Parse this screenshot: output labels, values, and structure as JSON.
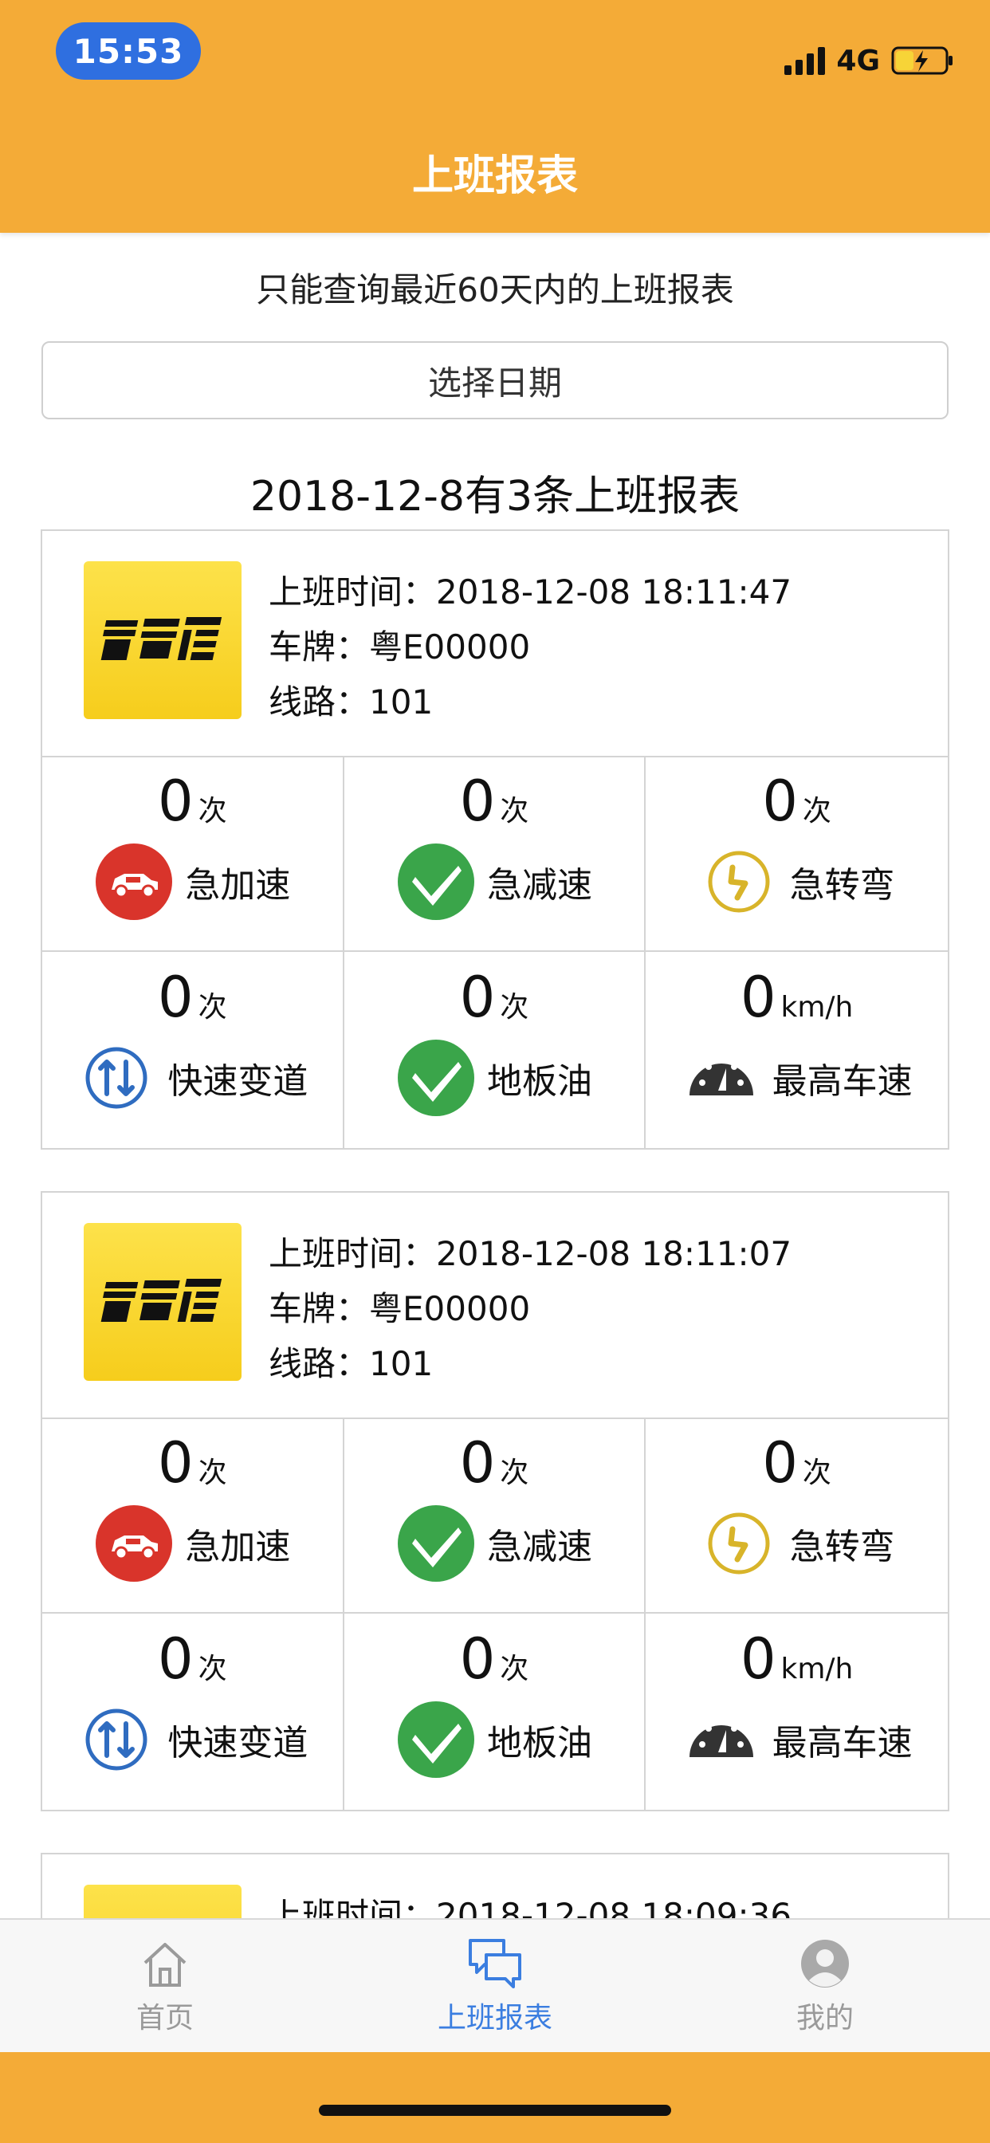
{
  "status_bar": {
    "time": "15:53",
    "network": "4G"
  },
  "header": {
    "title": "上班报表"
  },
  "notice": "只能查询最近60天内的上班报表",
  "date_button": "选择日期",
  "summary": "2018-12-8有3条上班报表",
  "info_labels": {
    "time": "上班时间：",
    "plate": "车牌：",
    "route": "线路："
  },
  "records": [
    {
      "start_time": "2018-12-08 18:11:47",
      "plate": "粤E00000",
      "route": "101",
      "metrics": [
        {
          "value": "0",
          "unit": "次",
          "label": "急加速"
        },
        {
          "value": "0",
          "unit": "次",
          "label": "急减速"
        },
        {
          "value": "0",
          "unit": "次",
          "label": "急转弯"
        },
        {
          "value": "0",
          "unit": "次",
          "label": "快速变道"
        },
        {
          "value": "0",
          "unit": "次",
          "label": "地板油"
        },
        {
          "value": "0",
          "unit": "km/h",
          "label": "最高车速"
        }
      ]
    },
    {
      "start_time": "2018-12-08 18:11:07",
      "plate": "粤E00000",
      "route": "101",
      "metrics": [
        {
          "value": "0",
          "unit": "次",
          "label": "急加速"
        },
        {
          "value": "0",
          "unit": "次",
          "label": "急减速"
        },
        {
          "value": "0",
          "unit": "次",
          "label": "急转弯"
        },
        {
          "value": "0",
          "unit": "次",
          "label": "快速变道"
        },
        {
          "value": "0",
          "unit": "次",
          "label": "地板油"
        },
        {
          "value": "0",
          "unit": "km/h",
          "label": "最高车速"
        }
      ]
    },
    {
      "start_time": "2018-12-08 18:09:36"
    }
  ],
  "metric_icons": [
    "car-red-icon",
    "check-green-icon",
    "turn-yellow-icon",
    "lane-change-icon",
    "check-green-icon",
    "speedometer-icon"
  ],
  "tabbar": [
    {
      "label": "首页",
      "icon": "home-icon"
    },
    {
      "label": "上班报表",
      "icon": "chat-icon"
    },
    {
      "label": "我的",
      "icon": "user-icon"
    }
  ],
  "colors": {
    "brand": "#f4ab37",
    "accent": "#3b7ee0",
    "red": "#d9342b",
    "green": "#3aa54a",
    "yellow": "#d8b42a"
  }
}
